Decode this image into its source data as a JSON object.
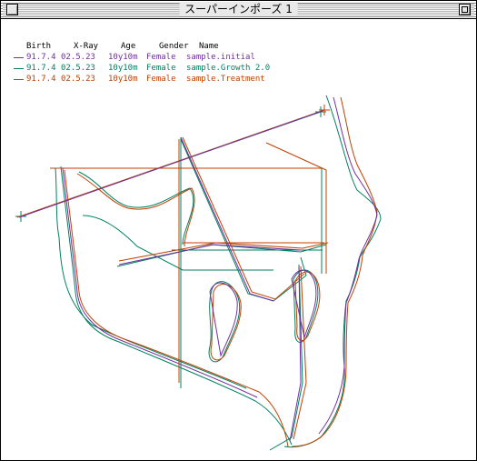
{
  "window": {
    "title": "スーパーインポーズ 1"
  },
  "legend": {
    "headers": {
      "birth": "Birth",
      "xray": "X-Ray",
      "age": "Age",
      "gender": "Gender",
      "name": "Name"
    },
    "rows": [
      {
        "birth": "91.7.4",
        "xray": "02.5.23",
        "age": "10y10m",
        "gender": "Female",
        "name": "sample.initial",
        "color": "#7030a0"
      },
      {
        "birth": "91.7.4",
        "xray": "02.5.23",
        "age": "10y10m",
        "gender": "Female",
        "name": "sample.Growth 2.0",
        "color": "#008060"
      },
      {
        "birth": "91.7.4",
        "xray": "02.5.23",
        "age": "10y10m",
        "gender": "Female",
        "name": "sample.Treatment",
        "color": "#c04000"
      }
    ]
  },
  "colors": {
    "initial": "#7030a0",
    "growth": "#008060",
    "treatment": "#c04000"
  },
  "icons": {
    "close": "close-box-icon",
    "zoom": "zoom-box-icon"
  }
}
